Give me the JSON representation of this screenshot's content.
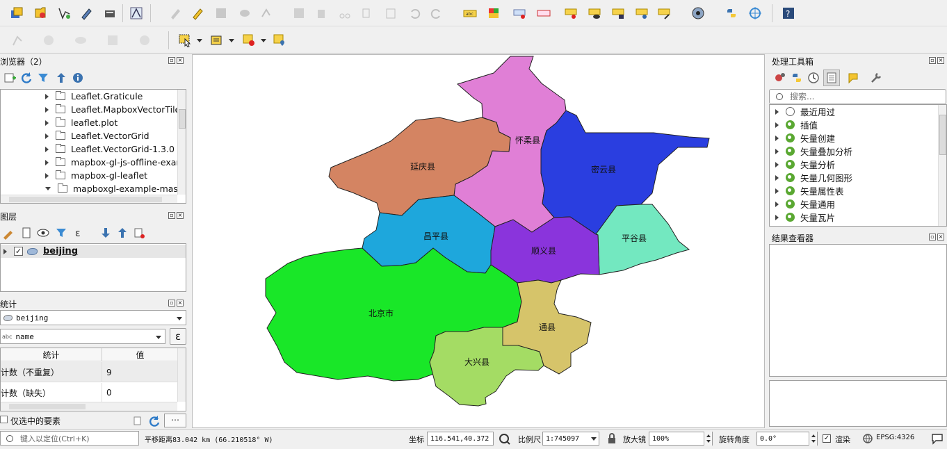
{
  "toolbar1": {
    "icons": [
      "open-project-icon",
      "save-project-icon",
      "digitize-icon",
      "pen-icon",
      "data-source-icon",
      "vector-node-icon",
      "edit-toggle-icon",
      "pencil-icon",
      "save-edits-icon",
      "add-feature-icon",
      "vertex-tool-icon",
      "attribute-table-icon",
      "delete-icon",
      "cut-icon",
      "copy-icon",
      "paste-icon",
      "undo-icon",
      "redo-icon",
      "label-abc-icon",
      "diagram-icon",
      "label-pin-icon",
      "label-red-icon",
      "label-move-icon",
      "label-show-icon",
      "label-rotate-icon",
      "label-change-icon",
      "label-edit-icon",
      "globe-plugin-icon",
      "python-icon",
      "georef-icon",
      "help-icon"
    ]
  },
  "browser": {
    "title": "浏览器（2）",
    "items": [
      {
        "label": "Leaflet.Graticule"
      },
      {
        "label": "Leaflet.MapboxVectorTile"
      },
      {
        "label": "leaflet.plot"
      },
      {
        "label": "Leaflet.VectorGrid"
      },
      {
        "label": "Leaflet.VectorGrid-1.3.0"
      },
      {
        "label": "mapbox-gl-js-offline-exam"
      },
      {
        "label": "mapbox-gl-leaflet"
      },
      {
        "label": "mapboxgl-example-maste"
      }
    ]
  },
  "layers": {
    "title": "图层",
    "layer_name": "beijing"
  },
  "stats": {
    "title": "统计",
    "layer_select": "beijing",
    "field_select": "name",
    "field_prefix": "abc",
    "expr_symbol": "ε",
    "col_stat": "统计",
    "col_value": "值",
    "rows": [
      {
        "stat": "计数（不重复）",
        "value": "9"
      },
      {
        "stat": "计数（缺失）",
        "value": "0"
      }
    ],
    "selected_only_label": "仅选中的要素",
    "more_label": "⋯"
  },
  "map": {
    "regions": [
      {
        "name": "怀柔县",
        "color": "#e07fd6"
      },
      {
        "name": "延庆县",
        "color": "#d48462"
      },
      {
        "name": "密云县",
        "color": "#2a3ee0"
      },
      {
        "name": "平谷县",
        "color": "#73e8c0"
      },
      {
        "name": "昌平县",
        "color": "#1ea7dc"
      },
      {
        "name": "顺义县",
        "color": "#8a34dc"
      },
      {
        "name": "北京市",
        "color": "#19e728"
      },
      {
        "name": "通县",
        "color": "#d6c46a"
      },
      {
        "name": "大兴县",
        "color": "#a4dc64"
      }
    ]
  },
  "toolbox": {
    "title": "处理工具箱",
    "search_placeholder": "搜索...",
    "items": [
      {
        "label": "最近用过",
        "icon": "clock-icon"
      },
      {
        "label": "插值",
        "icon": "qgis-icon"
      },
      {
        "label": "矢量创建",
        "icon": "qgis-icon"
      },
      {
        "label": "矢量叠加分析",
        "icon": "qgis-icon"
      },
      {
        "label": "矢量分析",
        "icon": "qgis-icon"
      },
      {
        "label": "矢量几何图形",
        "icon": "qgis-icon"
      },
      {
        "label": "矢量属性表",
        "icon": "qgis-icon"
      },
      {
        "label": "矢量通用",
        "icon": "qgis-icon"
      },
      {
        "label": "矢量瓦片",
        "icon": "qgis-icon"
      }
    ]
  },
  "results": {
    "title": "结果查看器"
  },
  "status": {
    "locator_placeholder": "键入以定位(Ctrl+K)",
    "message": "平移距离83.042 km (66.210518° W)",
    "coord_label": "坐标",
    "coord_value": "116.541,40.372",
    "scale_label": "比例尺",
    "scale_value": "1:745097",
    "magnifier_label": "放大镜",
    "magnifier_value": "100%",
    "rotation_label": "旋转角度",
    "rotation_value": "0.0°",
    "render_label": "渲染",
    "crs_label": "EPSG:4326"
  }
}
